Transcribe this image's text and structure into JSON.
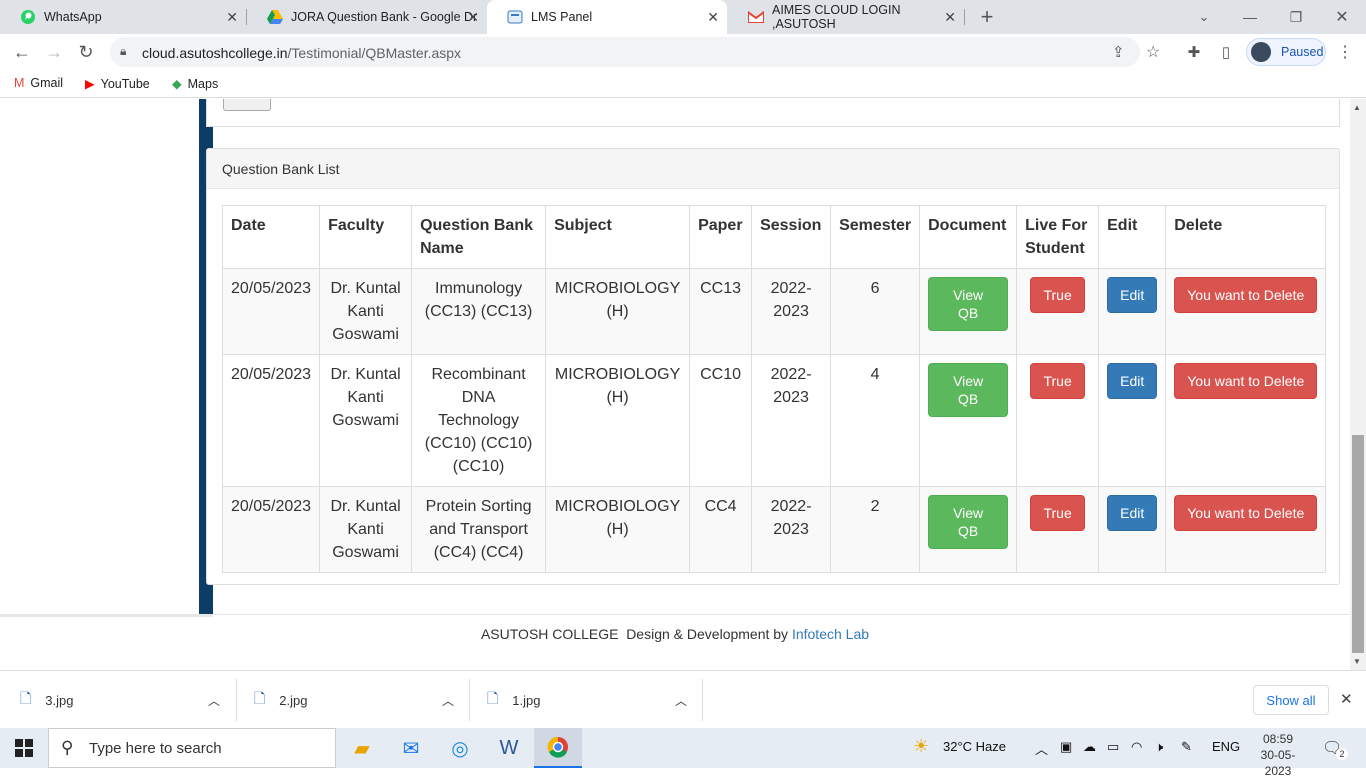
{
  "browser": {
    "tabs": [
      {
        "title": "WhatsApp",
        "icon": "whatsapp-icon"
      },
      {
        "title": "JORA Question Bank - Google Dr",
        "icon": "google-drive-icon"
      },
      {
        "title": "LMS Panel",
        "icon": "lms-icon"
      },
      {
        "title": "AIMES CLOUD LOGIN ,ASUTOSH",
        "icon": "gmail-icon"
      }
    ],
    "url_domain": "cloud.asutoshcollege.in",
    "url_path": "/Testimonial/QBMaster.aspx",
    "profile_status": "Paused",
    "bookmarks": [
      "Gmail",
      "YouTube",
      "Maps"
    ]
  },
  "page": {
    "card_title": "Question Bank List",
    "table": {
      "headers": [
        "Date",
        "Faculty",
        "Question Bank Name",
        "Subject",
        "Paper",
        "Session",
        "Semester",
        "Document",
        "Live For Student",
        "Edit",
        "Delete"
      ],
      "rows": [
        {
          "date": "20/05/2023",
          "faculty": "Dr. Kuntal Kanti Goswami",
          "qb_name": "Immunology (CC13) (CC13)",
          "subject": "MICROBIOLOGY (H)",
          "paper": "CC13",
          "session": "2022-2023",
          "semester": "6",
          "doc_btn": "View QB",
          "live_btn": "True",
          "edit_btn": "Edit",
          "delete_btn": "You want to Delete"
        },
        {
          "date": "20/05/2023",
          "faculty": "Dr. Kuntal Kanti Goswami",
          "qb_name": "Recombinant DNA Technology (CC10) (CC10) (CC10)",
          "subject": "MICROBIOLOGY (H)",
          "paper": "CC10",
          "session": "2022-2023",
          "semester": "4",
          "doc_btn": "View QB",
          "live_btn": "True",
          "edit_btn": "Edit",
          "delete_btn": "You want to Delete"
        },
        {
          "date": "20/05/2023",
          "faculty": "Dr. Kuntal Kanti Goswami",
          "qb_name": "Protein Sorting and Transport (CC4) (CC4)",
          "subject": "MICROBIOLOGY (H)",
          "paper": "CC4",
          "session": "2022-2023",
          "semester": "2",
          "doc_btn": "View QB",
          "live_btn": "True",
          "edit_btn": "Edit",
          "delete_btn": "You want to Delete"
        }
      ]
    },
    "footer_text": "ASUTOSH COLLEGE  Design & Development by ",
    "footer_link": "Infotech Lab"
  },
  "downloads": {
    "files": [
      "3.jpg",
      "2.jpg",
      "1.jpg"
    ],
    "show_all": "Show all"
  },
  "taskbar": {
    "search_placeholder": "Type here to search",
    "weather": "32°C  Haze",
    "language": "ENG",
    "time": "08:59",
    "date": "30-05-2023",
    "notifications": "2"
  },
  "colors": {
    "green": "#5cb85c",
    "red": "#d9534f",
    "blue": "#337ab7",
    "sidebar": "#0d3c66"
  }
}
